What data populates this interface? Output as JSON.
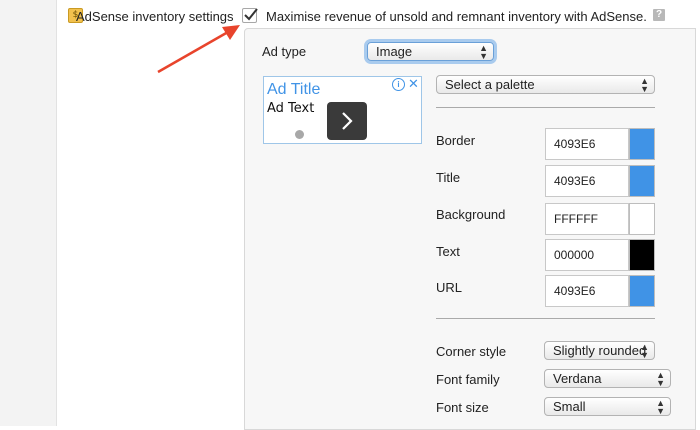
{
  "setting": {
    "label": "AdSense inventory settings",
    "checkbox_label": "Maximise revenue of unsold and remnant inventory with AdSense.",
    "checked": true,
    "help_glyph": "?"
  },
  "panel": {
    "ad_type_label": "Ad type",
    "ad_type_value": "Image",
    "palette_select": "Select a palette",
    "preview": {
      "title": "Ad Title",
      "text": "Ad Text",
      "info_glyph": "i",
      "close_glyph": "✕"
    },
    "colors": [
      {
        "label": "Border",
        "value": "4093E6",
        "swatch": "#4093E6"
      },
      {
        "label": "Title",
        "value": "4093E6",
        "swatch": "#4093E6"
      },
      {
        "label": "Background",
        "value": "FFFFFF",
        "swatch": "#FFFFFF"
      },
      {
        "label": "Text",
        "value": "000000",
        "swatch": "#000000"
      },
      {
        "label": "URL",
        "value": "4093E6",
        "swatch": "#4093E6"
      }
    ],
    "corner_style_label": "Corner style",
    "corner_style_value": "Slightly rounded",
    "font_family_label": "Font family",
    "font_family_value": "Verdana",
    "font_size_label": "Font size",
    "font_size_value": "Small"
  },
  "accent_color": "#4093E6",
  "arrow_color": "#e8442c",
  "icons": [
    "adsense-icon",
    "checkmark-icon",
    "help-icon",
    "info-icon",
    "close-icon",
    "chevron-right-icon",
    "select-chevrons-icon",
    "arrow-annotation"
  ]
}
